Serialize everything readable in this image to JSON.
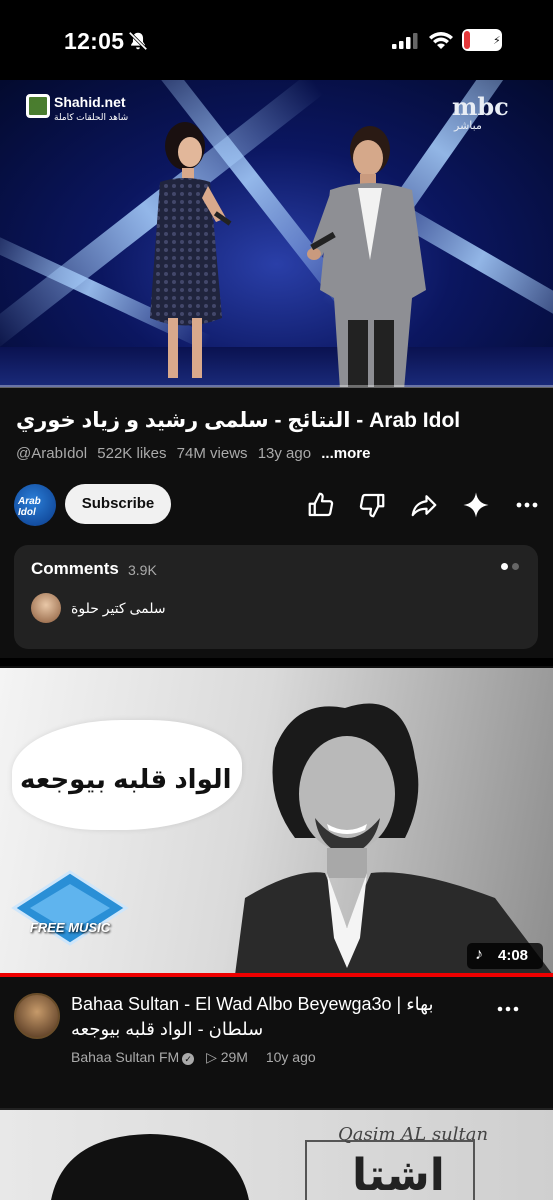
{
  "status_bar": {
    "time": "12:05",
    "battery": "16",
    "battery_level": 0.16,
    "icons": [
      "bell-off-icon",
      "cellular-signal-icon",
      "wifi-icon",
      "battery-icon"
    ]
  },
  "player": {
    "watermark_left_name": "Shahid.net",
    "watermark_left_sub": "شاهد الحلقات كاملة",
    "watermark_right_name": "mbc",
    "watermark_right_sub": "مباشر",
    "progress": 0
  },
  "video": {
    "title": "النتائج - سلمى رشيد و زياد خوري - Arab Idol",
    "channel_handle": "@ArabIdol",
    "likes": "522K likes",
    "views": "74M views",
    "age": "13y ago",
    "more_label": "...more",
    "channel_avatar_text": "Arab Idol",
    "subscribe_label": "Subscribe"
  },
  "actions": [
    {
      "icon": "like-icon"
    },
    {
      "icon": "dislike-icon"
    },
    {
      "icon": "share-icon"
    },
    {
      "icon": "sparkle-icon"
    },
    {
      "icon": "more-options-icon"
    }
  ],
  "comments": {
    "label": "Comments",
    "count": "3.9K",
    "top_comment": "سلمى كتير حلوة"
  },
  "next_video": {
    "thumbnail_title": "الواد قلبه بيوجعه",
    "thumbnail_logo": "FREE MUSIC",
    "duration": "4:08",
    "progress": 1.0,
    "title": "Bahaa Sultan - El Wad Albo Beyewga3o | بهاء سلطان - الواد قلبه بيوجعه",
    "channel": "Bahaa Sultan FM",
    "views": "29M",
    "age": "10y ago"
  },
  "third_video": {
    "thumbnail_text": "Qasim AL sultan",
    "thumbnail_big": "اشتا"
  }
}
